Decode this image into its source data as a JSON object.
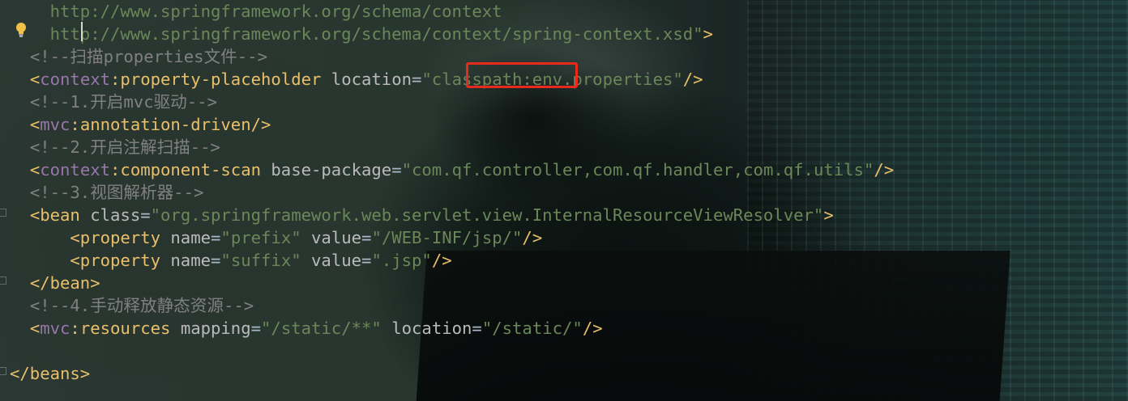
{
  "editor": {
    "lines": [
      {
        "indent": "    ",
        "segments": [
          {
            "t": "url",
            "v": "http://www.springframework.org/schema/context"
          }
        ]
      },
      {
        "indent": "    ",
        "segments": [
          {
            "t": "url",
            "v": "http://www.springframework.org/schema/context/spring-context.xsd\""
          },
          {
            "t": "tag",
            "v": ">"
          }
        ]
      },
      {
        "indent": "  ",
        "segments": [
          {
            "t": "cmt",
            "v": "<!--扫描properties文件-->"
          }
        ]
      },
      {
        "indent": "  ",
        "segments": [
          {
            "t": "tag",
            "v": "<"
          },
          {
            "t": "ns",
            "v": "context"
          },
          {
            "t": "tag",
            "v": ":property-placeholder "
          },
          {
            "t": "attr",
            "v": "location"
          },
          {
            "t": "plain",
            "v": "="
          },
          {
            "t": "val",
            "v": "\"classpath:env.properties\""
          },
          {
            "t": "tag",
            "v": "/>"
          }
        ]
      },
      {
        "indent": "  ",
        "segments": [
          {
            "t": "cmt",
            "v": "<!--1.开启mvc驱动-->"
          }
        ]
      },
      {
        "indent": "  ",
        "segments": [
          {
            "t": "tag",
            "v": "<"
          },
          {
            "t": "ns",
            "v": "mvc"
          },
          {
            "t": "tag",
            "v": ":annotation-driven/>"
          }
        ]
      },
      {
        "indent": "  ",
        "segments": [
          {
            "t": "cmt",
            "v": "<!--2.开启注解扫描-->"
          }
        ]
      },
      {
        "indent": "  ",
        "segments": [
          {
            "t": "tag",
            "v": "<"
          },
          {
            "t": "ns",
            "v": "context"
          },
          {
            "t": "tag",
            "v": ":component-scan "
          },
          {
            "t": "attr",
            "v": "base-package"
          },
          {
            "t": "plain",
            "v": "="
          },
          {
            "t": "val",
            "v": "\"com.qf.controller,com.qf.handler,com.qf.utils\""
          },
          {
            "t": "tag",
            "v": "/>"
          }
        ]
      },
      {
        "indent": "  ",
        "segments": [
          {
            "t": "cmt",
            "v": "<!--3.视图解析器-->"
          }
        ]
      },
      {
        "indent": "  ",
        "segments": [
          {
            "t": "tag",
            "v": "<bean "
          },
          {
            "t": "attr",
            "v": "class"
          },
          {
            "t": "plain",
            "v": "="
          },
          {
            "t": "val",
            "v": "\"org.springframework.web.servlet.view.InternalResourceViewResolver\""
          },
          {
            "t": "tag",
            "v": ">"
          }
        ]
      },
      {
        "indent": "      ",
        "segments": [
          {
            "t": "tag",
            "v": "<property "
          },
          {
            "t": "attr",
            "v": "name"
          },
          {
            "t": "plain",
            "v": "="
          },
          {
            "t": "val",
            "v": "\"prefix\""
          },
          {
            "t": "plain",
            "v": " "
          },
          {
            "t": "attr",
            "v": "value"
          },
          {
            "t": "plain",
            "v": "="
          },
          {
            "t": "val",
            "v": "\"/WEB-INF/jsp/\""
          },
          {
            "t": "tag",
            "v": "/>"
          }
        ]
      },
      {
        "indent": "      ",
        "segments": [
          {
            "t": "tag",
            "v": "<property "
          },
          {
            "t": "attr",
            "v": "name"
          },
          {
            "t": "plain",
            "v": "="
          },
          {
            "t": "val",
            "v": "\"suffix\""
          },
          {
            "t": "plain",
            "v": " "
          },
          {
            "t": "attr",
            "v": "value"
          },
          {
            "t": "plain",
            "v": "="
          },
          {
            "t": "val",
            "v": "\".jsp\""
          },
          {
            "t": "tag",
            "v": "/>"
          }
        ]
      },
      {
        "indent": "  ",
        "segments": [
          {
            "t": "tag",
            "v": "</bean>"
          }
        ]
      },
      {
        "indent": "  ",
        "segments": [
          {
            "t": "cmt",
            "v": "<!--4.手动释放静态资源-->"
          }
        ]
      },
      {
        "indent": "  ",
        "segments": [
          {
            "t": "tag",
            "v": "<"
          },
          {
            "t": "ns",
            "v": "mvc"
          },
          {
            "t": "tag",
            "v": ":resources "
          },
          {
            "t": "attr",
            "v": "mapping"
          },
          {
            "t": "plain",
            "v": "="
          },
          {
            "t": "val",
            "v": "\"/static/**\""
          },
          {
            "t": "plain",
            "v": " "
          },
          {
            "t": "attr",
            "v": "location"
          },
          {
            "t": "plain",
            "v": "="
          },
          {
            "t": "val",
            "v": "\"/static/\""
          },
          {
            "t": "tag",
            "v": "/>"
          }
        ]
      },
      {
        "indent": "",
        "segments": []
      },
      {
        "indent": "",
        "segments": [
          {
            "t": "tag",
            "v": "</beans>"
          }
        ]
      }
    ]
  },
  "highlight": {
    "text": "classpath:",
    "color": "#e8291c"
  },
  "gutter": {
    "intention_icon": "lightbulb-icon",
    "fold_icon": "fold-marker-icon"
  },
  "colors": {
    "tag": "#e8bf6a",
    "namespace": "#9876aa",
    "attribute": "#bababa",
    "value": "#6a8759",
    "comment": "#808080"
  }
}
